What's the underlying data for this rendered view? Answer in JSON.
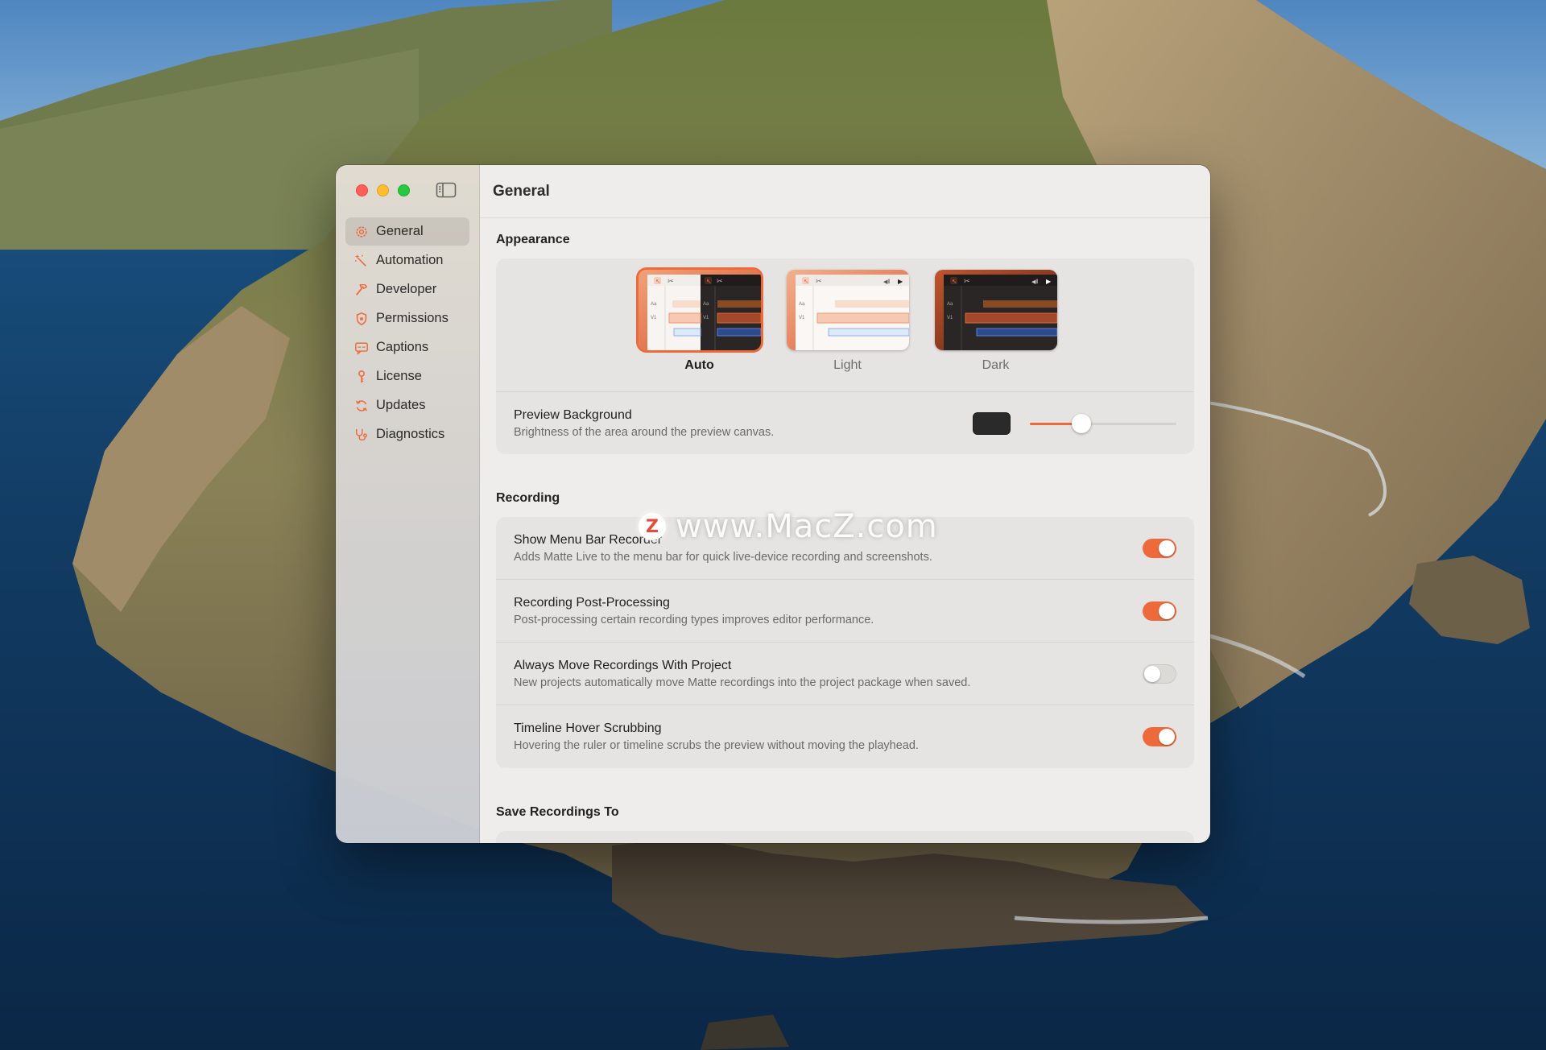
{
  "window": {
    "title": "General",
    "sidebar": {
      "items": [
        {
          "label": "General",
          "icon": "gear-icon",
          "active": true
        },
        {
          "label": "Automation",
          "icon": "magic-wand-icon",
          "active": false
        },
        {
          "label": "Developer",
          "icon": "hammer-icon",
          "active": false
        },
        {
          "label": "Permissions",
          "icon": "shield-icon",
          "active": false
        },
        {
          "label": "Captions",
          "icon": "captions-icon",
          "active": false
        },
        {
          "label": "License",
          "icon": "key-icon",
          "active": false
        },
        {
          "label": "Updates",
          "icon": "refresh-icon",
          "active": false
        },
        {
          "label": "Diagnostics",
          "icon": "stethoscope-icon",
          "active": false
        }
      ]
    }
  },
  "appearance": {
    "section_title": "Appearance",
    "options": [
      {
        "label": "Auto",
        "selected": true
      },
      {
        "label": "Light",
        "selected": false
      },
      {
        "label": "Dark",
        "selected": false
      }
    ],
    "preview_background": {
      "title": "Preview Background",
      "description": "Brightness of the area around the preview canvas.",
      "swatch_color": "#2a2a2a",
      "slider_value": 0.35
    }
  },
  "recording": {
    "section_title": "Recording",
    "settings": [
      {
        "title": "Show Menu Bar Recorder",
        "description": "Adds Matte Live to the menu bar for quick live-device recording and screenshots.",
        "on": true
      },
      {
        "title": "Recording Post-Processing",
        "description": "Post-processing certain recording types improves editor performance.",
        "on": true
      },
      {
        "title": "Always Move Recordings With Project",
        "description": "New projects automatically move Matte recordings into the project package when saved.",
        "on": false
      },
      {
        "title": "Timeline Hover Scrubbing",
        "description": "Hovering the ruler or timeline scrubs the preview without moving the playhead.",
        "on": true
      }
    ]
  },
  "save_recordings": {
    "section_title": "Save Recordings To"
  },
  "watermark": {
    "logo": "Z",
    "text": "www.MacZ.com"
  },
  "thumb_labels": {
    "aa": "Aa",
    "v1": "V1"
  },
  "colors": {
    "accent": "#ef6a3b",
    "close": "#ff5f57",
    "minimize": "#febc2e",
    "maximize": "#28c840"
  }
}
